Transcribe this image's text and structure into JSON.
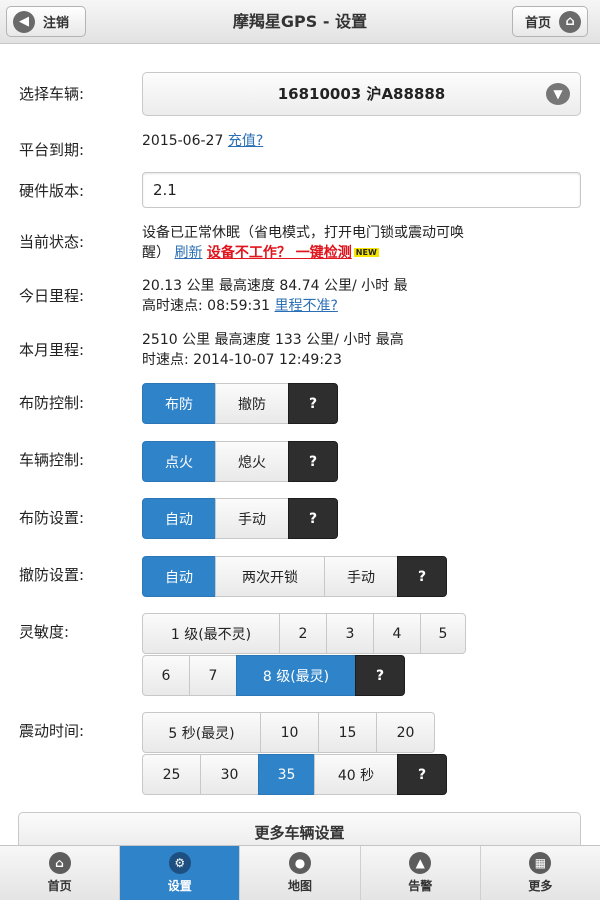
{
  "header": {
    "back_label": "注销",
    "title": "摩羯星GPS - 设置",
    "home_label": "首页"
  },
  "vehicle": {
    "label": "选择车辆:",
    "selected": "16810003 沪A88888"
  },
  "platform": {
    "label": "平台到期:",
    "date": "2015-06-27",
    "link": "充值?"
  },
  "hardware": {
    "label": "硬件版本:",
    "value": "2.1"
  },
  "status": {
    "label": "当前状态:",
    "text": "设备已正常休眠（省电模式，打开电门锁或震动可唤",
    "text2": "醒）",
    "refresh": "刷新",
    "broken_link": "设备不工作？ 一键检测",
    "badge": "NEW"
  },
  "today": {
    "label": "今日里程:",
    "line1": "20.13 公里   最高速度 84.74 公里/ 小时   最",
    "line2": "高时速点:   08:59:31",
    "link": "里程不准?"
  },
  "month": {
    "label": "本月里程:",
    "line1": "2510 公里   最高速度 133 公里/ 小时    最高",
    "line2": "时速点:   2014-10-07 12:49:23"
  },
  "arm_control": {
    "label": "布防控制:",
    "options": [
      "布防",
      "撤防",
      "?"
    ],
    "selected": "布防"
  },
  "vehicle_control": {
    "label": "车辆控制:",
    "options": [
      "点火",
      "熄火",
      "?"
    ],
    "selected": "点火"
  },
  "arm_setting": {
    "label": "布防设置:",
    "options": [
      "自动",
      "手动",
      "?"
    ],
    "selected": "自动"
  },
  "disarm_setting": {
    "label": "撤防设置:",
    "options": [
      "自动",
      "两次开锁",
      "手动",
      "?"
    ],
    "selected": "自动"
  },
  "sensitivity": {
    "label": "灵敏度:",
    "row1": [
      "1 级(最不灵)",
      "2",
      "3",
      "4",
      "5"
    ],
    "row2": [
      "6",
      "7",
      "8 级(最灵)",
      "?"
    ],
    "selected": "8 级(最灵)"
  },
  "vibration": {
    "label": "震动时间:",
    "row1": [
      "5 秒(最灵)",
      "10",
      "15",
      "20"
    ],
    "row2": [
      "25",
      "30",
      "35",
      "40 秒",
      "?"
    ],
    "selected": "35"
  },
  "more_button": "更多车辆设置",
  "tabbar": [
    {
      "label": "首页",
      "icon": "home-icon"
    },
    {
      "label": "设置",
      "icon": "gear-icon"
    },
    {
      "label": "地图",
      "icon": "map-pin-icon"
    },
    {
      "label": "告警",
      "icon": "warning-icon"
    },
    {
      "label": "更多",
      "icon": "grid-icon"
    }
  ],
  "active_tab": "设置",
  "colors": {
    "accent": "#2f83c9",
    "help_button": "#2e2e2e",
    "warning": "#e0141c",
    "link": "#2a6fb5"
  }
}
